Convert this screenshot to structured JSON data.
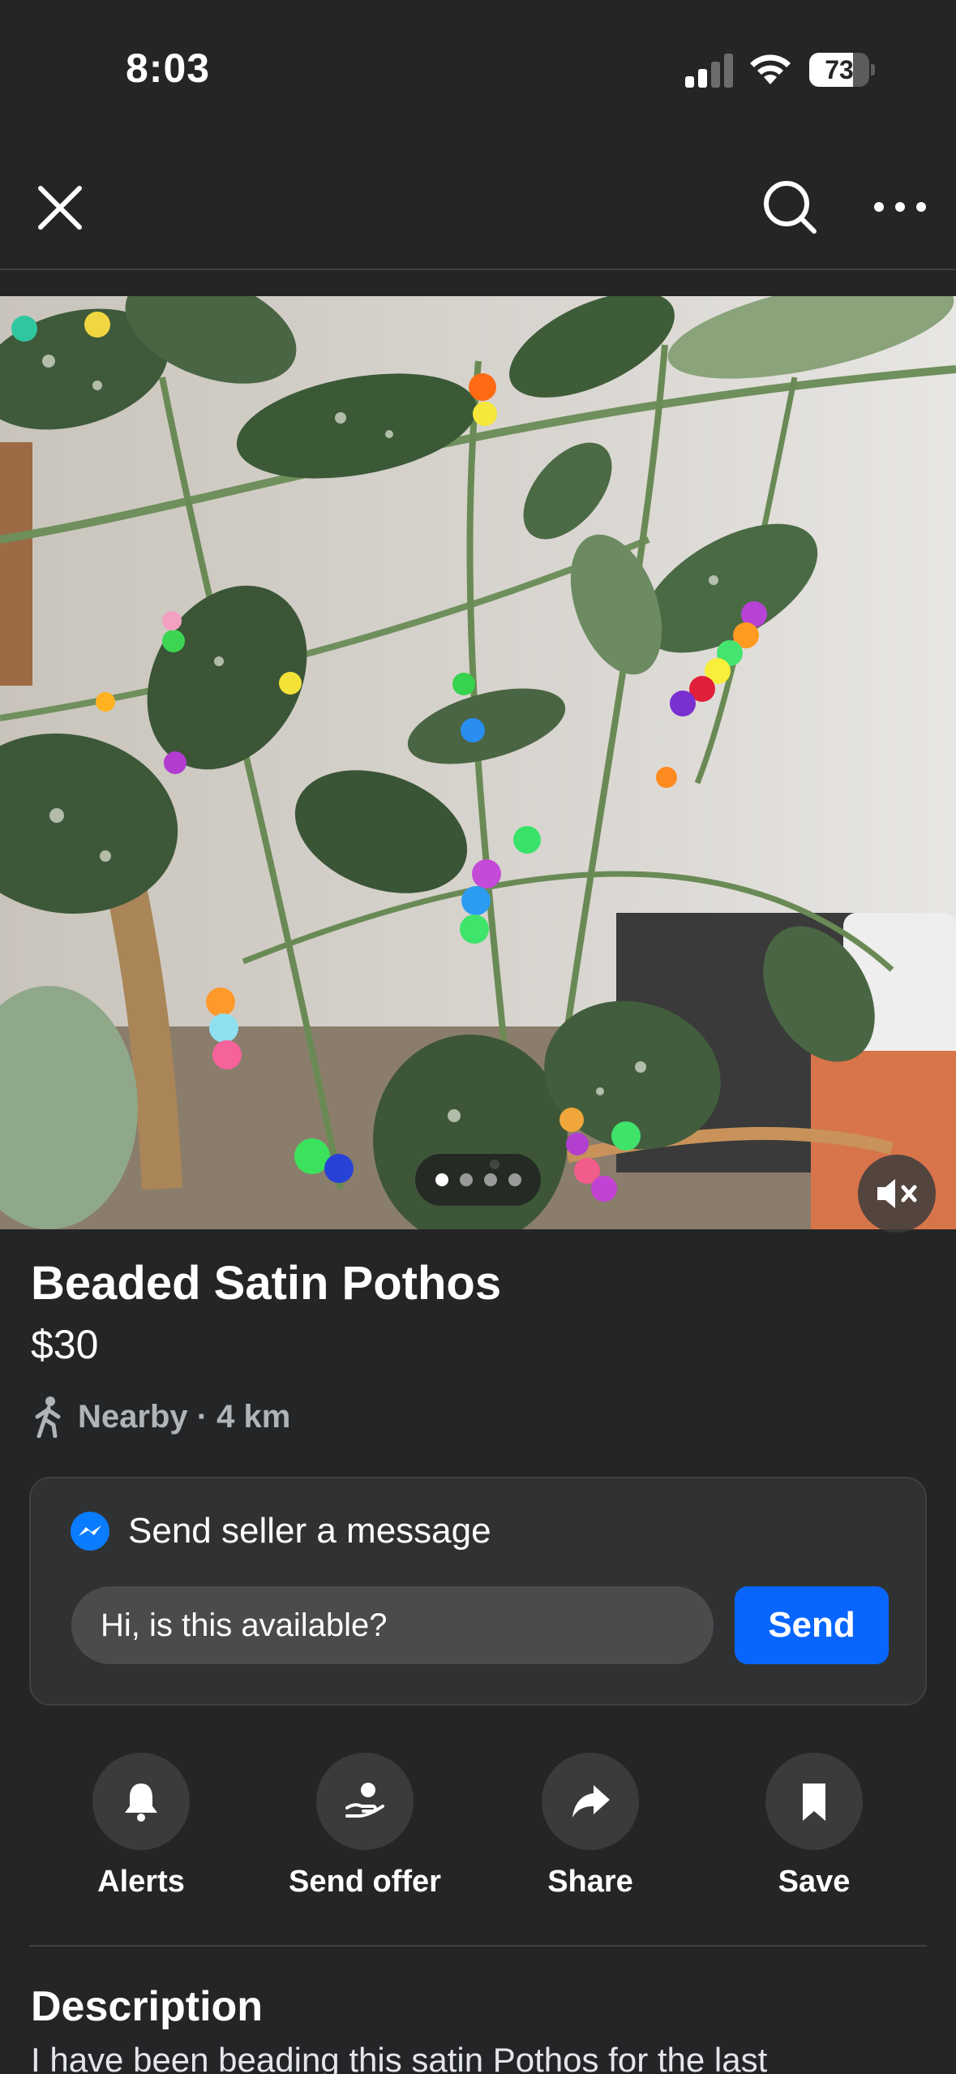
{
  "status_bar": {
    "time": "8:03",
    "battery_percent": 73,
    "battery_label": "73"
  },
  "top_bar": {
    "close_icon": "close-icon",
    "search_icon": "search-icon",
    "more_icon": "more-horizontal-icon"
  },
  "media": {
    "image_description_icon": "product-photo",
    "carousel_total": 4,
    "carousel_active": 1,
    "mute_icon": "speaker-muted-icon"
  },
  "listing": {
    "title": "Beaded Satin Pothos",
    "price": "$30",
    "location": "Nearby · 4 km"
  },
  "message": {
    "header": "Send seller a message",
    "input_value": "Hi, is this available?",
    "send_label": "Send"
  },
  "actions": [
    {
      "label": "Alerts",
      "icon": "bell-icon"
    },
    {
      "label": "Send offer",
      "icon": "offer-icon"
    },
    {
      "label": "Share",
      "icon": "share-icon"
    },
    {
      "label": "Save",
      "icon": "bookmark-icon"
    }
  ],
  "description": {
    "heading": "Description",
    "text": "I have been beading this satin Pothos for the last"
  },
  "colors": {
    "background": "#242526",
    "card": "#303133",
    "accent": "#0866ff",
    "muted_text": "#b0b3b8"
  }
}
